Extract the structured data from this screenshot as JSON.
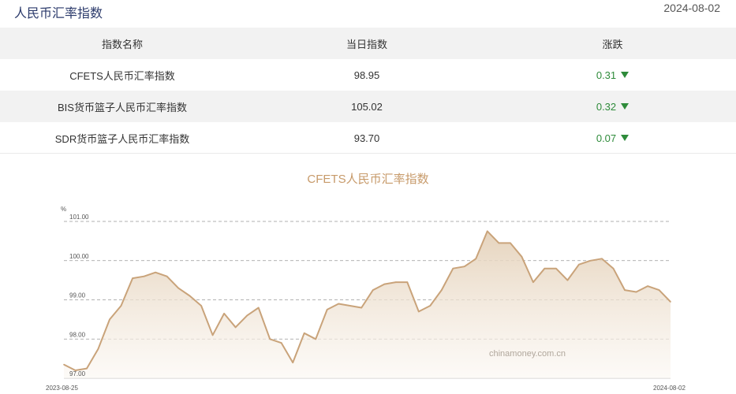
{
  "header": {
    "title": "人民币汇率指数",
    "date": "2024-08-02"
  },
  "table": {
    "columns": [
      "指数名称",
      "当日指数",
      "涨跌"
    ],
    "rows": [
      {
        "name": "CFETS人民币汇率指数",
        "value": "98.95",
        "change": "0.31",
        "direction": "down"
      },
      {
        "name": "BIS货币篮子人民币汇率指数",
        "value": "105.02",
        "change": "0.32",
        "direction": "down"
      },
      {
        "name": "SDR货币篮子人民币汇率指数",
        "value": "93.70",
        "change": "0.07",
        "direction": "down"
      }
    ]
  },
  "chart_data": {
    "type": "area",
    "title": "CFETS人民币汇率指数",
    "ylabel": "%",
    "ylim": [
      97.0,
      101.0
    ],
    "yticks": [
      "97.00",
      "98.00",
      "99.00",
      "100.00",
      "101.00"
    ],
    "x_start_label": "2023-08-25",
    "x_end_label": "2024-08-02",
    "watermark": "chinamoney.com.cn",
    "colors": {
      "line": "#c9a37a",
      "fill_top": "#e3cfb6",
      "fill_bottom": "#fbf7f2",
      "grid": "#999999"
    },
    "series": [
      {
        "values": [
          97.35,
          97.2,
          97.25,
          97.75,
          98.5,
          98.85,
          99.55,
          99.6,
          99.7,
          99.6,
          99.3,
          99.1,
          98.85,
          98.1,
          98.65,
          98.3,
          98.6,
          98.8,
          98.0,
          97.9,
          97.4,
          98.15,
          98.0,
          98.75,
          98.9,
          98.85,
          98.8,
          99.25,
          99.4,
          99.45,
          99.45,
          98.7,
          98.85,
          99.25,
          99.8,
          99.85,
          100.05,
          100.75,
          100.45,
          100.45,
          100.1,
          99.45,
          99.8,
          99.8,
          99.5,
          99.9,
          100.0,
          100.05,
          99.8,
          99.25,
          99.2,
          99.35,
          99.25,
          98.95
        ]
      }
    ]
  }
}
